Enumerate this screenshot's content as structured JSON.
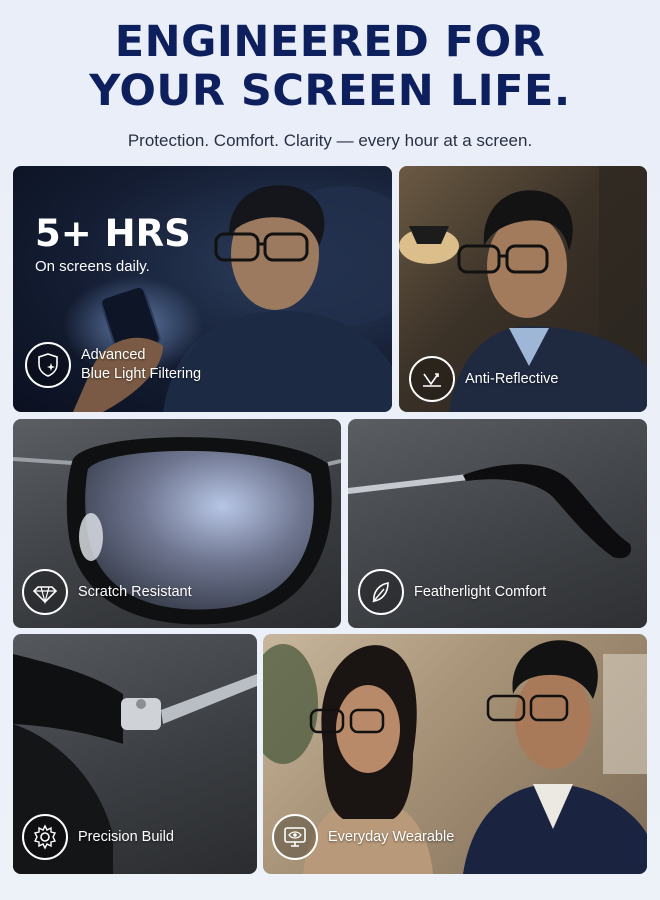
{
  "headline": {
    "line1": "ENGINEERED FOR",
    "line2": "YOUR SCREEN LIFE."
  },
  "tagline": "Protection. Comfort. Clarity — every hour at a screen.",
  "colors": {
    "headline": "#0d1f5c",
    "background": "#e9eef8",
    "badge": "#ffffff"
  },
  "cards": [
    {
      "stat_value": "5+ HRS",
      "stat_caption": "On screens daily.",
      "feature_line1": "Advanced",
      "feature_line2": "Blue Light Filtering",
      "icon": "shield-sparkle-icon"
    },
    {
      "feature": "Anti-Reflective",
      "icon": "reflection-arrows-icon"
    },
    {
      "feature": "Scratch Resistant",
      "icon": "diamond-icon"
    },
    {
      "feature": "Featherlight Comfort",
      "icon": "feather-icon"
    },
    {
      "feature": "Precision Build",
      "icon": "gear-icon"
    },
    {
      "feature": "Everyday Wearable",
      "icon": "eye-monitor-icon"
    }
  ]
}
